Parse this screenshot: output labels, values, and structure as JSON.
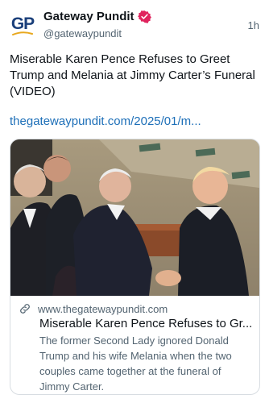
{
  "account": {
    "display_name": "Gateway Pundit",
    "handle": "@gatewaypundit",
    "avatar_text": "GP",
    "verified_badge_icon": "verified-badge-icon"
  },
  "post": {
    "time": "1h",
    "text": "Miserable Karen Pence Refuses to Greet Trump and Melania at Jimmy Carter’s Funeral (VIDEO)",
    "link": "thegatewaypundit.com/2025/01/m..."
  },
  "card": {
    "domain": "www.thegatewaypundit.com",
    "title": "Miserable Karen Pence Refuses to Gr...",
    "description": "The former Second Lady ignored Donald Trump and his wife Melania when the two couples came together at the funeral of Jimmy Carter.",
    "link_icon": "link-icon",
    "image_subject": "men in dark suits shaking hands at a funeral service"
  },
  "colors": {
    "link": "#1d6fb8",
    "secondary_text": "#536471",
    "badge": "#e0245e",
    "avatar_text": "#1a3f7a",
    "avatar_swoosh": "#e8a81e"
  }
}
